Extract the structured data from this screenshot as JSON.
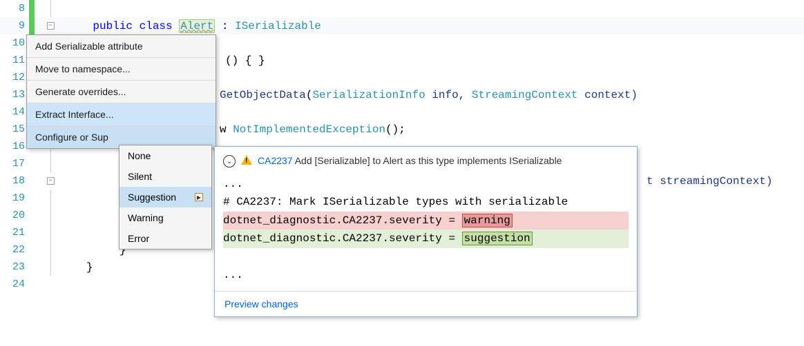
{
  "gutter": {
    "lines": [
      "8",
      "9",
      "10",
      "11",
      "12",
      "13",
      "14",
      "15",
      "16",
      "17",
      "18",
      "19",
      "20",
      "21",
      "22",
      "23",
      "24"
    ]
  },
  "code": {
    "line9_public": "public",
    "line9_class": "class",
    "line9_name": "Alert",
    "line9_colon": " : ",
    "line9_iface": "ISerializable",
    "line11_tail": "() { }",
    "line13_method": "GetObjectData",
    "line13_p1type": "SerializationInfo",
    "line13_p1name": " info, ",
    "line13_p2type": "StreamingContext",
    "line13_p2name": " context)",
    "line13_open": "(",
    "line15_w": "w ",
    "line15_exc": "NotImplementedException",
    "line15_tail": "();",
    "line18_tail_t": "t ",
    "line18_tail_name": "streamingContext)",
    "line22_brace": "}",
    "line23_brace": "}"
  },
  "menu1": {
    "items": [
      "Add Serializable attribute",
      "Move to namespace...",
      "Generate overrides...",
      "Extract Interface...",
      "Configure or Sup"
    ]
  },
  "menu2": {
    "items": [
      "None",
      "Silent",
      "Suggestion",
      "Warning",
      "Error"
    ]
  },
  "preview": {
    "rule_id": "CA2237",
    "header_text": "Add [Serializable] to Alert as this type implements ISerializable",
    "body_ellipsis": "...",
    "comment": "# CA2237: Mark ISerializable types with serializable",
    "diff_prefix": "dotnet_diagnostic.CA2237.severity = ",
    "diff_old": "warning",
    "diff_new": "suggestion",
    "footer": "Preview changes"
  }
}
